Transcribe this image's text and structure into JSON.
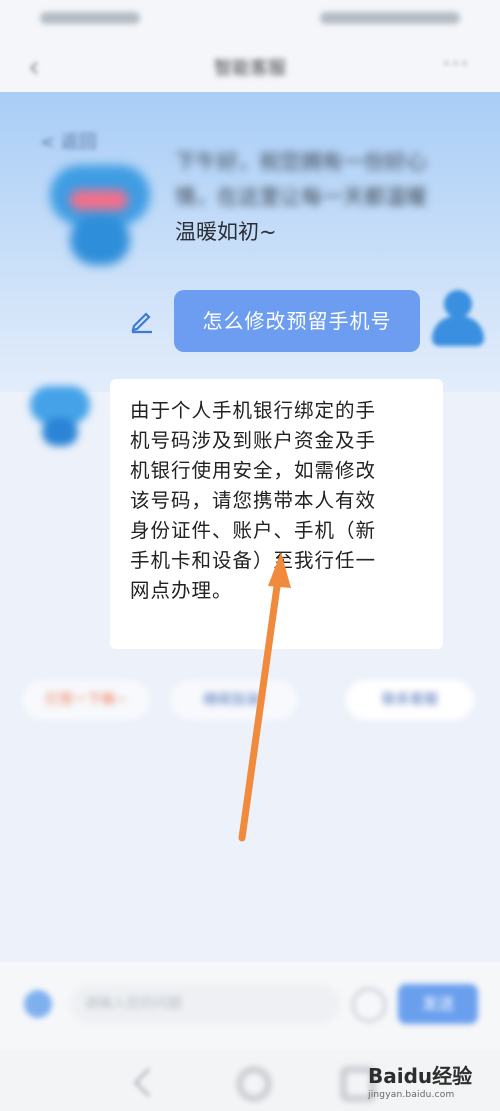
{
  "header": {
    "title": "智能客服",
    "back_icon": "chevron-left-icon",
    "more_label": "···"
  },
  "greeting": {
    "prev_label": "< 返回",
    "text_blur": "下午好，祝您拥有一份好心情，在这里让每一天都温暖",
    "text_clear": "温暖如初~"
  },
  "question": {
    "text": "怎么修改预留手机号",
    "edit_icon": "edit-icon"
  },
  "answer": {
    "lines": [
      "由于个人手机银行绑定的手",
      "机号码涉及到账户资金及手",
      "机银行使用安全，如需修改",
      "该号码，请您携带本人有效",
      "身份证件、账户、手机（新",
      "手机卡和设备）至我行任一",
      "网点办理。"
    ]
  },
  "chips": {
    "chip1": "打赏一下嘛~",
    "chip2": "继续加油!",
    "chip3": "联系客服"
  },
  "input": {
    "placeholder": "请输入您的问题",
    "send_label": "发送"
  },
  "watermark": {
    "main": "Baidu经验",
    "sub": "jingyan.baidu.com"
  },
  "colors": {
    "accent": "#6c9df0",
    "arrow": "#f08a3c",
    "bubble_bg": "#ffffff"
  }
}
